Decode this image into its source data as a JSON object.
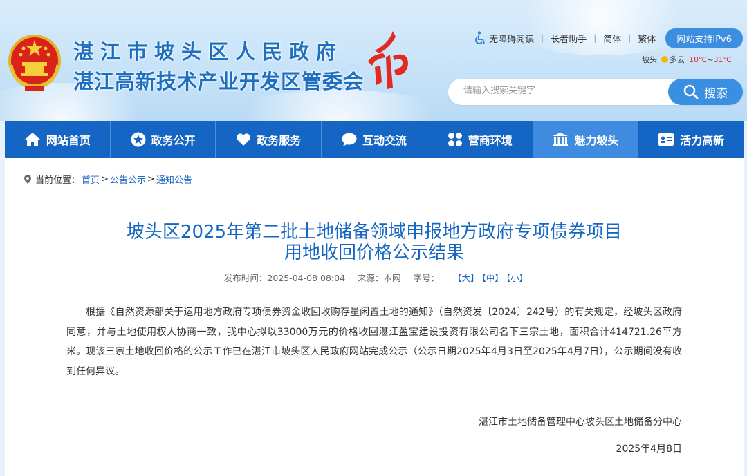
{
  "header": {
    "title": "湛江市坡头区人民政府",
    "subtitle": "湛江高新技术产业开发区管委会",
    "toolbar": {
      "accessible": "无障碍阅读",
      "elder": "长者助手",
      "simplified": "简体",
      "traditional": "繁体",
      "ipv6": "网站支持IPv6"
    },
    "weather": {
      "city": "坡头",
      "condition": "多云",
      "temp_low": "18℃",
      "temp_sep": "~",
      "temp_high": "31℃"
    },
    "search": {
      "placeholder": "请输入搜索关键字",
      "button": "搜索"
    }
  },
  "nav": {
    "items": [
      {
        "label": "网站首页",
        "icon": "home-icon"
      },
      {
        "label": "政务公开",
        "icon": "star-icon"
      },
      {
        "label": "政务服务",
        "icon": "heart-icon"
      },
      {
        "label": "互动交流",
        "icon": "chat-icon"
      },
      {
        "label": "营商环境",
        "icon": "grid-icon"
      },
      {
        "label": "魅力坡头",
        "icon": "landmark-icon"
      },
      {
        "label": "活力高新",
        "icon": "card-icon"
      }
    ],
    "active_index": 5
  },
  "breadcrumb": {
    "prefix": "当前位置：",
    "items": [
      "首页",
      "公告公示",
      "通知公告"
    ],
    "separator": ">"
  },
  "article": {
    "title_line1": "坡头区2025年第二批土地储备领域申报地方政府专项债券项目",
    "title_line2": "用地收回价格公示结果",
    "meta": {
      "publish_time": "发布时间：2025-04-08 08:04",
      "source": "来源：本网",
      "font_label": "字号：",
      "font_large": "【大】",
      "font_medium": "【中】",
      "font_small": "【小】"
    },
    "paragraph": "根据《自然资源部关于运用地方政府专项债券资金收回收购存量闲置土地的通知》（自然资发〔2024〕242号）的有关规定，经坡头区政府同意，并与土地使用权人协商一致，我中心拟以33000万元的价格收回湛江盈宝建设投资有限公司名下三宗土地，面积合计414721.26平方米。现该三宗土地收回价格的公示工作已在湛江市坡头区人民政府网站完成公示（公示日期2025年4月3日至2025年4月7日），公示期间没有收到任何异议。",
    "signer": "湛江市土地储备管理中心坡头区土地储备分中心",
    "date": "2025年4月8日"
  },
  "colors": {
    "nav_bg": "#1566c4",
    "nav_active": "#3f8be0",
    "title_blue": "#1667c3",
    "link_blue": "#1a66c2",
    "temp_red": "#e3342f"
  }
}
